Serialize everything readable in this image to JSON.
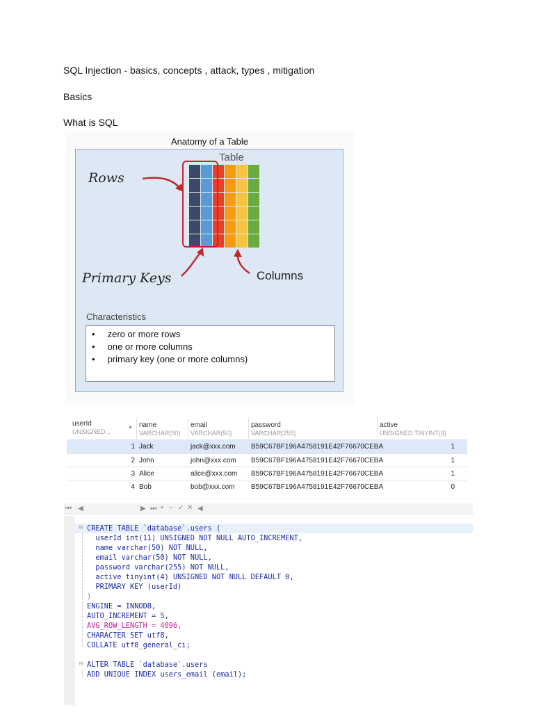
{
  "doc": {
    "heading": "SQL Injection - basics, concepts , attack, types , mitigation",
    "section": "Basics",
    "subsection": "What is SQL"
  },
  "figure": {
    "title": "Anatomy of a Table",
    "rows_label": "Rows",
    "table_label": "Table",
    "primary_keys_label": "Primary Keys",
    "columns_label": "Columns",
    "characteristics_title": "Characteristics",
    "characteristics": [
      "zero or more rows",
      "one or more columns",
      "primary key (one or more columns)"
    ],
    "colors": {
      "panel": "#dde8f4",
      "pk_dark": "#3a4a68",
      "pk_blue": "#5b9bd5",
      "col_red": "#e8402c",
      "col_orange": "#f39c12",
      "col_yellow": "#f5c542",
      "col_green": "#6aaa3f",
      "highlight": "#c0282d"
    }
  },
  "grid": {
    "columns": [
      {
        "name": "userId",
        "type": "UNSIGNED..."
      },
      {
        "name": "name",
        "type": "VARCHAR(50)"
      },
      {
        "name": "email",
        "type": "VARCHAR(50)"
      },
      {
        "name": "password",
        "type": "VARCHAR(255)"
      },
      {
        "name": "active",
        "type": "UNSIGNED TINYINT(4)"
      }
    ],
    "rows": [
      {
        "userId": "1",
        "name": "Jack",
        "email": "jack@xxx.com",
        "password": "B59C67BF196A4758191E42F76670CEBA",
        "active": "1"
      },
      {
        "userId": "2",
        "name": "John",
        "email": "john@xxx.com",
        "password": "B59C67BF196A4758191E42F76670CEBA",
        "active": "1"
      },
      {
        "userId": "3",
        "name": "Alice",
        "email": "alice@xxx.com",
        "password": "B59C67BF196A4758191E42F76670CEBA",
        "active": "1"
      },
      {
        "userId": "4",
        "name": "Bob",
        "email": "bob@xxx.com",
        "password": "B59C67BF196A4758191E42F76670CEBA",
        "active": "0"
      }
    ]
  },
  "toolbar": {
    "first": "⏮",
    "prev": "◀",
    "next": "▶",
    "last": "⏭",
    "add": "+",
    "remove": "−",
    "apply": "✓",
    "cancel": "✕",
    "scroll": "◀"
  },
  "code": {
    "lines": [
      "CREATE TABLE `database`.users (",
      "  userId int(11) UNSIGNED NOT NULL AUTO_INCREMENT,",
      "  name varchar(50) NOT NULL,",
      "  email varchar(50) NOT NULL,",
      "  password varchar(255) NOT NULL,",
      "  active tinyint(4) UNSIGNED NOT NULL DEFAULT 0,",
      "  PRIMARY KEY (userId)",
      ")",
      "ENGINE = INNODB,",
      "AUTO_INCREMENT = 5,",
      "AVG_ROW_LENGTH = 4096,",
      "CHARACTER SET utf8,",
      "COLLATE utf8_general_ci;",
      "",
      "ALTER TABLE `database`.users",
      "ADD UNIQUE INDEX users_email (email);"
    ]
  }
}
